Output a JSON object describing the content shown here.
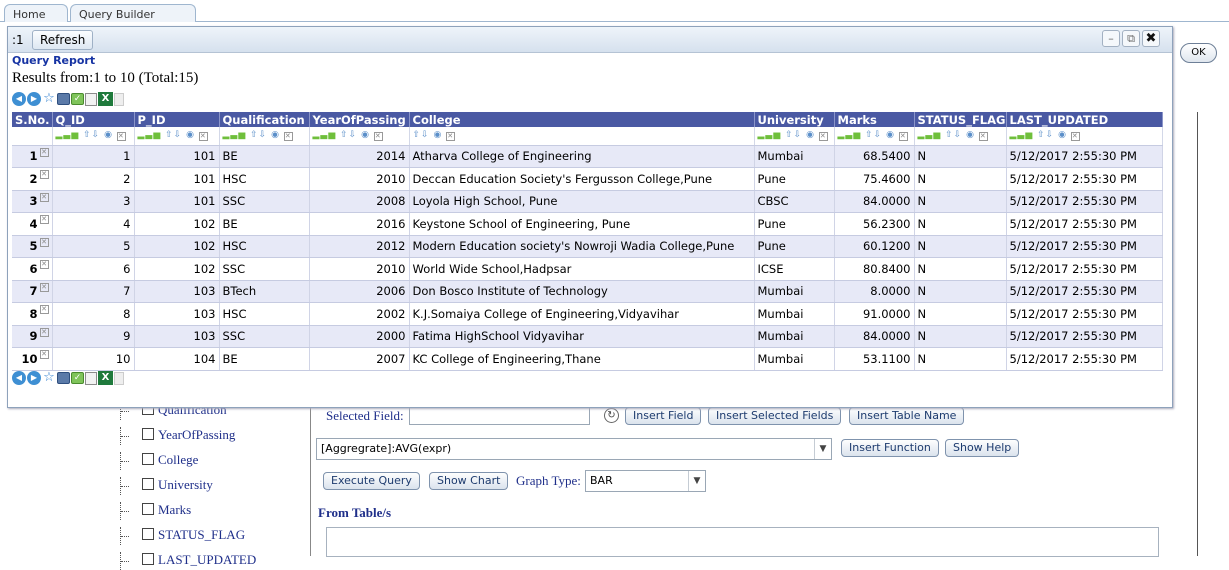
{
  "background": {
    "tabs": [
      "Home",
      "Query Builder"
    ],
    "ok_label": "OK",
    "tree_items": [
      "Qualification",
      "YearOfPassing",
      "College",
      "University",
      "Marks",
      "STATUS_FLAG",
      "LAST_UPDATED"
    ],
    "selected_field_label": "Selected Field:",
    "insert_field_label": "Insert Field",
    "insert_selected_fields_label": "Insert Selected Fields",
    "insert_table_name_label": "Insert Table Name",
    "function_select_value": "[Aggregrate]:AVG(expr)",
    "insert_function_label": "Insert Function",
    "show_help_label": "Show Help",
    "execute_query_label": "Execute Query",
    "show_chart_label": "Show Chart",
    "graph_type_label": "Graph Type:",
    "graph_type_value": "BAR",
    "from_tables_label": "From Table/s"
  },
  "dialog": {
    "counter": ":1",
    "refresh_label": "Refresh",
    "report_title": "Query Report",
    "results_text": "Results from:1 to 10 (Total:15)",
    "columns": [
      "S.No.",
      "Q_ID",
      "P_ID",
      "Qualification",
      "YearOfPassing",
      "College",
      "University",
      "Marks",
      "STATUS_FLAG",
      "LAST_UPDATED"
    ],
    "rows": [
      {
        "sno": "1",
        "q_id": "1",
        "p_id": "101",
        "qualification": "BE",
        "year": "2014",
        "college": "Atharva College of Engineering",
        "university": "Mumbai",
        "marks": "68.5400",
        "status": "N",
        "updated": "5/12/2017 2:55:30 PM"
      },
      {
        "sno": "2",
        "q_id": "2",
        "p_id": "101",
        "qualification": "HSC",
        "year": "2010",
        "college": "Deccan Education Society's Fergusson College,Pune",
        "university": "Pune",
        "marks": "75.4600",
        "status": "N",
        "updated": "5/12/2017 2:55:30 PM"
      },
      {
        "sno": "3",
        "q_id": "3",
        "p_id": "101",
        "qualification": "SSC",
        "year": "2008",
        "college": "Loyola High School, Pune",
        "university": "CBSC",
        "marks": "84.0000",
        "status": "N",
        "updated": "5/12/2017 2:55:30 PM"
      },
      {
        "sno": "4",
        "q_id": "4",
        "p_id": "102",
        "qualification": "BE",
        "year": "2016",
        "college": "Keystone School of Engineering, Pune",
        "university": "Pune",
        "marks": "56.2300",
        "status": "N",
        "updated": "5/12/2017 2:55:30 PM"
      },
      {
        "sno": "5",
        "q_id": "5",
        "p_id": "102",
        "qualification": "HSC",
        "year": "2012",
        "college": "Modern Education society's Nowroji Wadia College,Pune",
        "university": "Pune",
        "marks": "60.1200",
        "status": "N",
        "updated": "5/12/2017 2:55:30 PM"
      },
      {
        "sno": "6",
        "q_id": "6",
        "p_id": "102",
        "qualification": "SSC",
        "year": "2010",
        "college": "World Wide School,Hadpsar",
        "university": "ICSE",
        "marks": "80.8400",
        "status": "N",
        "updated": "5/12/2017 2:55:30 PM"
      },
      {
        "sno": "7",
        "q_id": "7",
        "p_id": "103",
        "qualification": "BTech",
        "year": "2006",
        "college": "Don Bosco Institute of Technology",
        "university": "Mumbai",
        "marks": "8.0000",
        "status": "N",
        "updated": "5/12/2017 2:55:30 PM"
      },
      {
        "sno": "8",
        "q_id": "8",
        "p_id": "103",
        "qualification": "HSC",
        "year": "2002",
        "college": "K.J.Somaiya College of Engineering,Vidyavihar",
        "university": "Mumbai",
        "marks": "91.0000",
        "status": "N",
        "updated": "5/12/2017 2:55:30 PM"
      },
      {
        "sno": "9",
        "q_id": "9",
        "p_id": "103",
        "qualification": "SSC",
        "year": "2000",
        "college": "Fatima HighSchool Vidyavihar",
        "university": "Mumbai",
        "marks": "84.0000",
        "status": "N",
        "updated": "5/12/2017 2:55:30 PM"
      },
      {
        "sno": "10",
        "q_id": "10",
        "p_id": "104",
        "qualification": "BE",
        "year": "2007",
        "college": "KC College of Engineering,Thane",
        "university": "Mumbai",
        "marks": "53.1100",
        "status": "N",
        "updated": "5/12/2017 2:55:30 PM"
      }
    ]
  }
}
